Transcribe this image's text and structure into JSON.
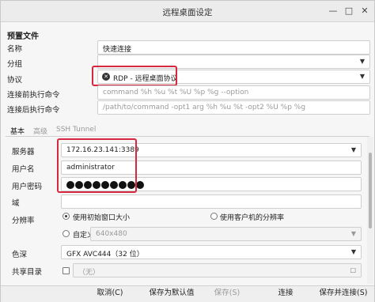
{
  "window": {
    "title": "远程桌面设定"
  },
  "preset": {
    "section": "预置文件",
    "name_label": "名称",
    "name_value": "快速连接",
    "group_label": "分组",
    "group_value": "",
    "protocol_label": "协议",
    "protocol_value": "RDP - 远程桌面协议",
    "pre_cmd_label": "连接前执行命令",
    "pre_cmd_placeholder": "command %h %u %t %U %p %g --option",
    "post_cmd_label": "连接后执行命令",
    "post_cmd_placeholder": "/path/to/command -opt1 arg %h %u %t -opt2 %U %p %g"
  },
  "tabs": [
    "基本",
    "高级",
    "SSH Tunnel"
  ],
  "basic": {
    "server_label": "服务器",
    "server_value": "172.16.23.141:3389",
    "user_label": "用户名",
    "user_value": "administrator",
    "password_label": "用户密码",
    "password_mask_count": 9,
    "domain_label": "域",
    "domain_value": "",
    "resolution_label": "分辨率",
    "res_option_initial": "使用初始窗口大小",
    "res_option_client": "使用客户机的分辨率",
    "res_option_custom": "自定义",
    "res_custom_value": "640x480",
    "color_label": "色深",
    "color_value": "GFX AVC444（32 位）",
    "share_label": "共享目录",
    "share_value": "（无）"
  },
  "footer": {
    "cancel": "取消(C)",
    "save_default": "保存为默认值",
    "save": "保存(S)",
    "connect": "连接",
    "save_connect": "保存并连接(S)"
  }
}
